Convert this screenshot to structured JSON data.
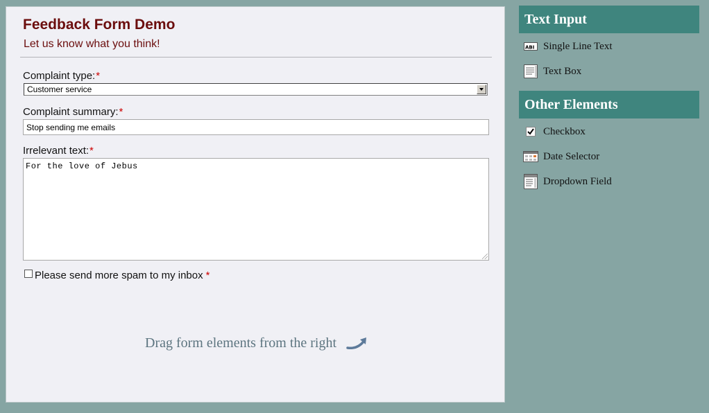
{
  "form": {
    "title": "Feedback Form Demo",
    "subtitle": "Let us know what you think!",
    "required_mark": "*",
    "complaint_type": {
      "label": "Complaint type:",
      "selected": "Customer service"
    },
    "complaint_summary": {
      "label": "Complaint summary:",
      "value": "Stop sending me emails"
    },
    "irrelevant_text": {
      "label": "Irrelevant text:",
      "value": "For the love of Jebus"
    },
    "spam_checkbox": {
      "label": "Please send more spam to my inbox",
      "checked": false
    },
    "drag_hint": "Drag form elements from the right"
  },
  "sidebar": {
    "text_input": {
      "header": "Text Input",
      "items": [
        {
          "label": "Single Line Text",
          "icon": "single-line-text-icon"
        },
        {
          "label": "Text Box",
          "icon": "text-box-icon"
        }
      ]
    },
    "other_elements": {
      "header": "Other Elements",
      "items": [
        {
          "label": "Checkbox",
          "icon": "checkbox-icon"
        },
        {
          "label": "Date Selector",
          "icon": "date-selector-icon"
        },
        {
          "label": "Dropdown Field",
          "icon": "dropdown-field-icon"
        }
      ]
    }
  },
  "colors": {
    "background": "#86a5a3",
    "panel": "#f0f0f5",
    "title": "#6b0d0d",
    "sidebar_header": "#3f857e",
    "required": "#cc0000"
  }
}
